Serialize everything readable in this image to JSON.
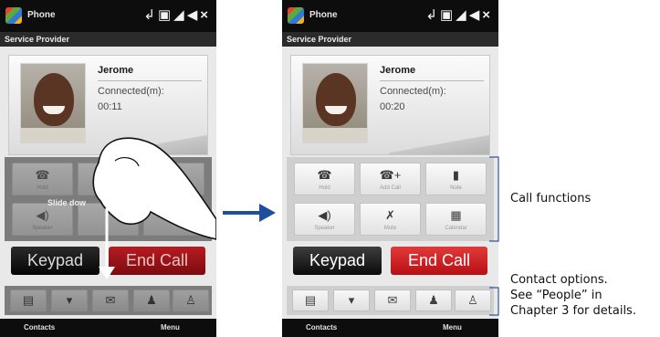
{
  "phone_left": {
    "app_title": "Phone",
    "close_glyph": "×",
    "subheader": "Service Provider",
    "contact_name": "Jerome",
    "connected_label": "Connected(m):",
    "connected_time": "00:11",
    "gesture_label": "Slide dow",
    "func_buttons": [
      {
        "label": "Hold",
        "icon": "hold-call-icon",
        "glyph": "☎"
      },
      {
        "label": "",
        "icon": "add-call-icon",
        "glyph": ""
      },
      {
        "label": "",
        "icon": "note-icon",
        "glyph": ""
      },
      {
        "label": "Speaker",
        "icon": "speaker-icon",
        "glyph": "◀)"
      },
      {
        "label": "",
        "icon": "mute-icon",
        "glyph": ""
      },
      {
        "label": "",
        "icon": "calendar-icon",
        "glyph": ""
      }
    ],
    "keypad_label": "Keypad",
    "endcall_label": "End Call",
    "contact_options": [
      {
        "icon": "contact-card-icon",
        "glyph": "▤"
      },
      {
        "icon": "sms-icon",
        "glyph": "▾"
      },
      {
        "icon": "email-icon",
        "glyph": "✉"
      },
      {
        "icon": "contact-details-icon",
        "glyph": "♟"
      },
      {
        "icon": "contact-list-icon",
        "glyph": "♙"
      }
    ],
    "softkey_left": "Contacts",
    "softkey_right": "Menu"
  },
  "phone_right": {
    "app_title": "Phone",
    "close_glyph": "×",
    "subheader": "Service Provider",
    "contact_name": "Jerome",
    "connected_label": "Connected(m):",
    "connected_time": "00:20",
    "func_buttons": [
      {
        "label": "Hold",
        "icon": "hold-call-icon",
        "glyph": "☎"
      },
      {
        "label": "Add Call",
        "icon": "add-call-icon",
        "glyph": "☎+"
      },
      {
        "label": "Note",
        "icon": "note-icon",
        "glyph": "▮"
      },
      {
        "label": "Speaker",
        "icon": "speaker-icon",
        "glyph": "◀)"
      },
      {
        "label": "Mute",
        "icon": "mute-icon",
        "glyph": "✗"
      },
      {
        "label": "Calendar",
        "icon": "calendar-icon",
        "glyph": "▦"
      }
    ],
    "keypad_label": "Keypad",
    "endcall_label": "End Call",
    "contact_options": [
      {
        "icon": "contact-card-icon",
        "glyph": "▤"
      },
      {
        "icon": "sms-icon",
        "glyph": "▾"
      },
      {
        "icon": "email-icon",
        "glyph": "✉"
      },
      {
        "icon": "contact-details-icon",
        "glyph": "♟"
      },
      {
        "icon": "contact-list-icon",
        "glyph": "♙"
      }
    ],
    "softkey_left": "Contacts",
    "softkey_right": "Menu"
  },
  "annotations": {
    "call_functions": "Call functions",
    "contact_options_line1": "Contact options.",
    "contact_options_line2": "See “People” in",
    "contact_options_line3": "Chapter 3 for details."
  },
  "colors": {
    "end_call_red": "#d3262b",
    "flow_arrow_blue": "#1f4e9c",
    "gesture_arrow_white": "#ffffff"
  }
}
